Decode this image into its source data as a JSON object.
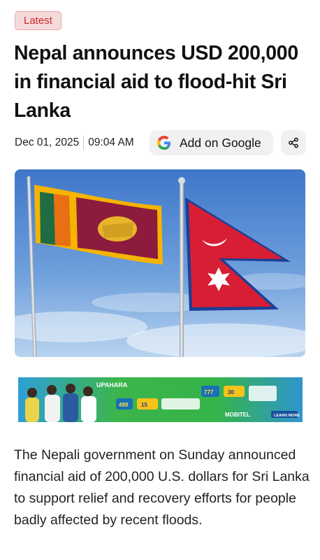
{
  "badge": {
    "label": "Latest"
  },
  "article": {
    "title": "Nepal announces USD 200,000 in financial aid to flood-hit Sri Lanka",
    "date": "Dec 01, 2025",
    "time": "09:04 AM",
    "body": "The Nepali government on Sunday announced financial aid of 200,000 U.S. dollars for Sri Lanka to support relief and recovery efforts for people badly affected by recent floods."
  },
  "actions": {
    "google_label": "Add on Google",
    "google_icon": "google-icon",
    "share_icon": "share-icon"
  },
  "ad": {
    "brand": "UPAHARA",
    "price_left": "499",
    "price_right": "777",
    "minutes": "15",
    "minutes_right": "30",
    "operator": "MOBITEL",
    "cta": "LEARN MORE"
  },
  "colors": {
    "accent_red": "#c62828",
    "sky_top": "#3f77c9",
    "sky_bottom": "#b7d3ef",
    "srilanka_maroon": "#8d1b3d",
    "nepal_crimson": "#d81e34",
    "nepal_blue": "#1c3f94",
    "ad_green": "#35b84a"
  }
}
